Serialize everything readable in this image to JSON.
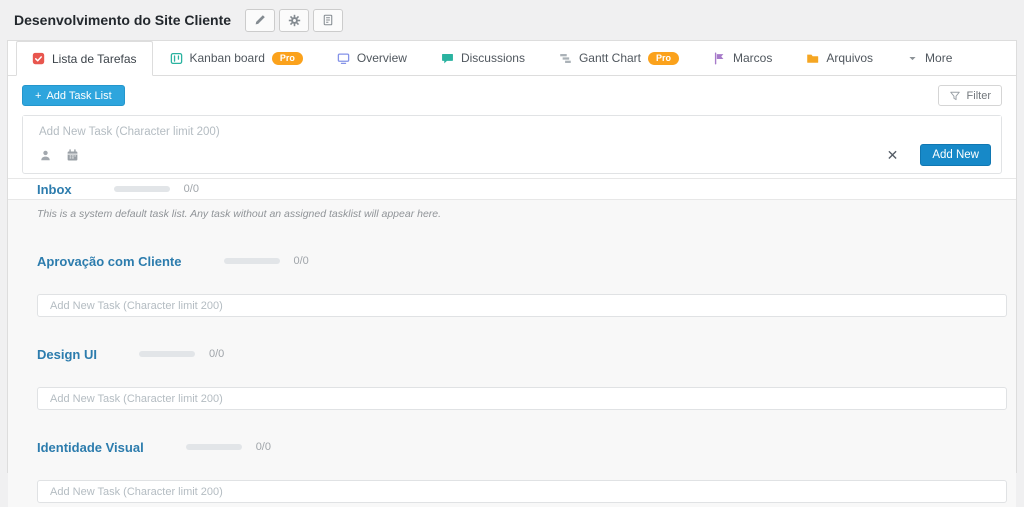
{
  "header": {
    "title": "Desenvolvimento do Site Cliente",
    "buttons": [
      {
        "name": "edit-project-button",
        "icon": "pencil-icon"
      },
      {
        "name": "project-settings-button",
        "icon": "gear-icon"
      },
      {
        "name": "project-notes-button",
        "icon": "document-icon"
      }
    ]
  },
  "tabs": [
    {
      "label": "Lista de Tarefas",
      "icon": "checklist-icon",
      "active": true
    },
    {
      "label": "Kanban board",
      "icon": "kanban-icon",
      "badge": "Pro"
    },
    {
      "label": "Overview",
      "icon": "monitor-icon"
    },
    {
      "label": "Discussions",
      "icon": "chat-icon"
    },
    {
      "label": "Gantt Chart",
      "icon": "gantt-icon",
      "badge": "Pro"
    },
    {
      "label": "Marcos",
      "icon": "flag-icon"
    },
    {
      "label": "Arquivos",
      "icon": "folder-icon"
    },
    {
      "label": "More",
      "icon": "caret-down-icon"
    }
  ],
  "toolbar": {
    "plus_glyph": "+",
    "add_task_list_label": "Add Task List",
    "filter_label": "Filter"
  },
  "new_task_form": {
    "placeholder": "Add New Task (Character limit 200)",
    "cancel_glyph": "✕",
    "submit_label": "Add New"
  },
  "sections": [
    {
      "name": "Inbox",
      "count": "0/0",
      "progress_percent": 0,
      "is_default": true,
      "description": "This is a system default task list. Any task without an assigned tasklist will appear here."
    },
    {
      "name": "Aprovação com Cliente",
      "count": "0/0",
      "progress_percent": 0,
      "input_placeholder": "Add New Task (Character limit 200)"
    },
    {
      "name": "Design UI",
      "count": "0/0",
      "progress_percent": 0,
      "input_placeholder": "Add New Task (Character limit 200)"
    },
    {
      "name": "Identidade Visual",
      "count": "0/0",
      "progress_percent": 0,
      "input_placeholder": "Add New Task (Character limit 200)"
    }
  ],
  "colors": {
    "accent_blue": "#2ea5dd",
    "submit_blue": "#1789c8",
    "pro_badge_orange": "#fba21c",
    "link_blue": "#2c7cad",
    "tab_red": "#e8564e",
    "tab_teal": "#2ab3a0",
    "tab_periwinkle": "#8492e8",
    "tab_purple": "#a77bca",
    "tab_orange": "#f5a623",
    "page_bg": "#f0f0f1"
  }
}
